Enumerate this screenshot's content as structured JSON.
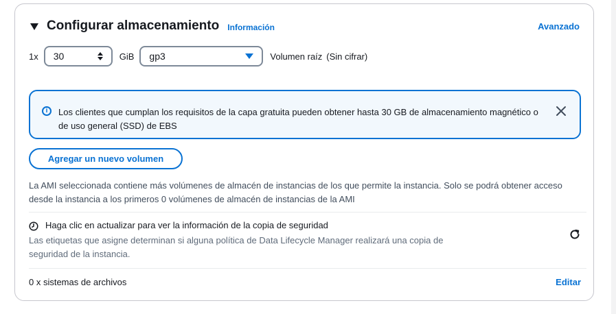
{
  "section": {
    "title": "Configurar almacenamiento",
    "info_link": "Información",
    "advanced_link": "Avanzado"
  },
  "volume": {
    "multiplier": "1x",
    "size_value": "30",
    "size_unit": "GiB",
    "type_value": "gp3",
    "root_label": "Volumen raíz",
    "root_sub": "(Sin cifrar)"
  },
  "alert": {
    "text": "Los clientes que cumplan los requisitos de la capa gratuita pueden obtener hasta 30 GB de almacenamiento magnético o de uso general (SSD) de EBS",
    "icon": "info-icon",
    "close_icon": "close-icon"
  },
  "actions": {
    "add_volume": "Agregar un nuevo volumen"
  },
  "ami_note": "La AMI seleccionada contiene más volúmenes de almacén de instancias de los que permite la instancia. Solo se podrá obtener acceso desde la instancia a los primeros 0 volúmenes de almacén de instancias de la AMI",
  "backup": {
    "title": "Haga clic en actualizar para ver la información de la copia de seguridad",
    "description": "Las etiquetas que asigne determinan si alguna política de Data Lifecycle Manager realizará una copia de seguridad de la instancia.",
    "icon": "clock-icon",
    "refresh_icon": "refresh-icon"
  },
  "filesystems": {
    "label": "0 x sistemas de archivos",
    "edit_link": "Editar"
  },
  "colors": {
    "accent": "#0972d3",
    "alert_bg": "#f2f8fd",
    "text": "#16191f",
    "muted": "#5f6b7a"
  }
}
